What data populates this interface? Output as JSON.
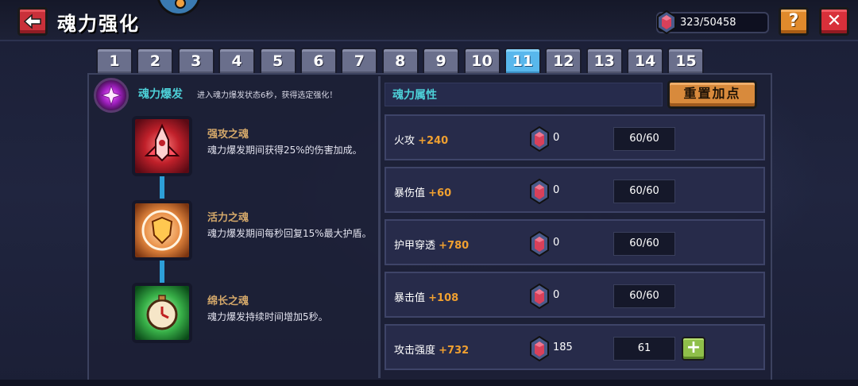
{
  "header": {
    "title": "魂力强化",
    "currency": "323/50458",
    "help_label": "?",
    "close_label": "✕"
  },
  "tabs": [
    "1",
    "2",
    "3",
    "4",
    "5",
    "6",
    "7",
    "8",
    "9",
    "10",
    "11",
    "12",
    "13",
    "14",
    "15"
  ],
  "active_tab": "11",
  "burst": {
    "title": "魂力爆发",
    "description": "进入魂力爆发状态6秒，获得选定强化！"
  },
  "skills": [
    {
      "name": "强攻之魂",
      "description": "魂力爆发期间获得25%的伤害加成。",
      "icon": "red-soul-icon"
    },
    {
      "name": "活力之魂",
      "description": "魂力爆发期间每秒回复15%最大护盾。",
      "icon": "shield-soul-icon"
    },
    {
      "name": "绵长之魂",
      "description": "魂力爆发持续时间增加5秒。",
      "icon": "clock-soul-icon"
    }
  ],
  "attributes": {
    "title": "魂力属性",
    "reset_label": "重置加点",
    "rows": [
      {
        "name": "火攻",
        "bonus": "+240",
        "cost": "0",
        "level": "60/60",
        "can_add": false
      },
      {
        "name": "暴伤值",
        "bonus": "+60",
        "cost": "0",
        "level": "60/60",
        "can_add": false
      },
      {
        "name": "护甲穿透",
        "bonus": "+780",
        "cost": "0",
        "level": "60/60",
        "can_add": false
      },
      {
        "name": "暴击值",
        "bonus": "+108",
        "cost": "0",
        "level": "60/60",
        "can_add": false
      },
      {
        "name": "攻击强度",
        "bonus": "+732",
        "cost": "185",
        "level": "61",
        "can_add": true
      }
    ],
    "plus_label": "+"
  },
  "colors": {
    "accent_cyan": "#4dd0d8",
    "bonus_orange": "#f0a030",
    "active_tab": "#58b7ec"
  }
}
